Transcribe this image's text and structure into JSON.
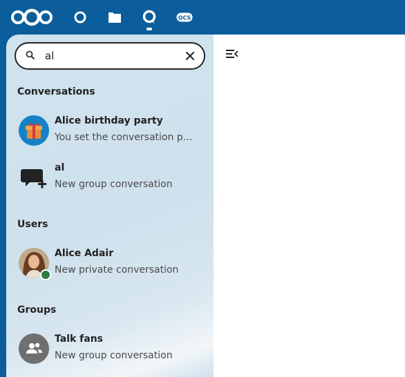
{
  "header": {
    "logo": "nextcloud-logo",
    "apps": [
      {
        "name": "dashboard",
        "icon": "circle-icon"
      },
      {
        "name": "files",
        "icon": "folder-icon"
      },
      {
        "name": "talk",
        "icon": "talk-icon"
      },
      {
        "name": "ocs",
        "label": "OCS",
        "icon": "ocs-icon"
      }
    ],
    "colors": {
      "background": "#0b5d9b",
      "icon": "#ffffff"
    }
  },
  "search": {
    "value": "al",
    "icon": "search-icon",
    "clear_icon": "close-icon"
  },
  "sections": {
    "conversations": "Conversations",
    "users": "Users",
    "groups": "Groups"
  },
  "conversations": [
    {
      "title": "Alice birthday party",
      "subtitle": "You set the conversation picture",
      "avatar": "gift-icon"
    },
    {
      "title": "al",
      "subtitle": "New group conversation",
      "avatar": "new-conversation-icon"
    }
  ],
  "users": [
    {
      "title": "Alice Adair",
      "subtitle": "New private conversation",
      "status": "online",
      "status_color": "#2d7b41"
    }
  ],
  "groups": [
    {
      "title": "Talk fans",
      "subtitle": "New group conversation",
      "avatar": "group-icon"
    }
  ],
  "main": {
    "toggle_icon": "menu-close-icon"
  }
}
